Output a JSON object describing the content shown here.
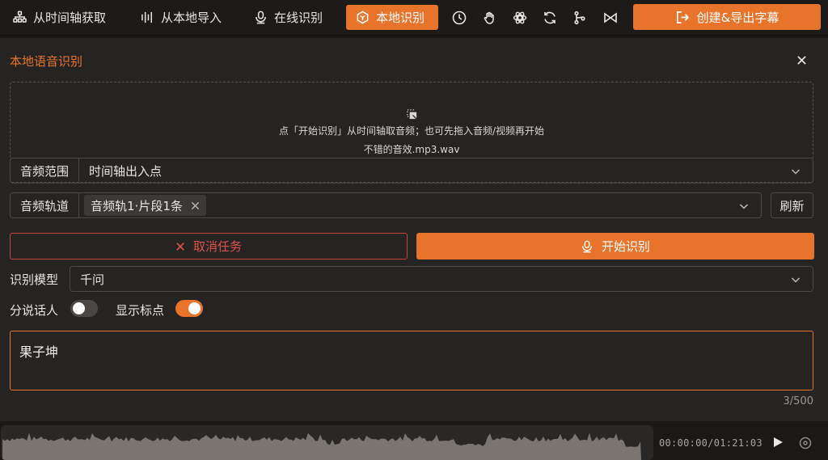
{
  "toolbar": {
    "timeline_get": "从时间轴获取",
    "local_import": "从本地导入",
    "online_recognize": "在线识别",
    "local_recognize": "本地识别",
    "export": "创建&导出字幕",
    "icons": [
      "clock-icon",
      "hand-gesture-icon",
      "openai-icon",
      "refresh-cycle-icon",
      "branch-icon",
      "bowtie-icon"
    ]
  },
  "panel": {
    "title": "本地语音识别",
    "dropzone": {
      "hint": "点「开始识别」从时间轴取音频；也可先拖入音频/视频再开始",
      "filename": "不错的音效.mp3.wav"
    },
    "audio_range": {
      "label": "音频范围",
      "value": "时间轴出入点"
    },
    "audio_track": {
      "label": "音频轨道",
      "tag": "音频轨1·片段1条",
      "refresh": "刷新"
    },
    "cancel": "取消任务",
    "start": "开始识别",
    "model": {
      "label": "识别模型",
      "value": "千问"
    },
    "speaker_diarization": {
      "label": "分说话人",
      "enabled": false
    },
    "punctuation": {
      "label": "显示标点",
      "enabled": true
    },
    "text": "果子坤",
    "counter": "3/500"
  },
  "player": {
    "timecode": "00:00:00/01:21:03"
  },
  "colors": {
    "accent": "#e8742c",
    "danger": "#e0524d",
    "background": "#262422"
  }
}
